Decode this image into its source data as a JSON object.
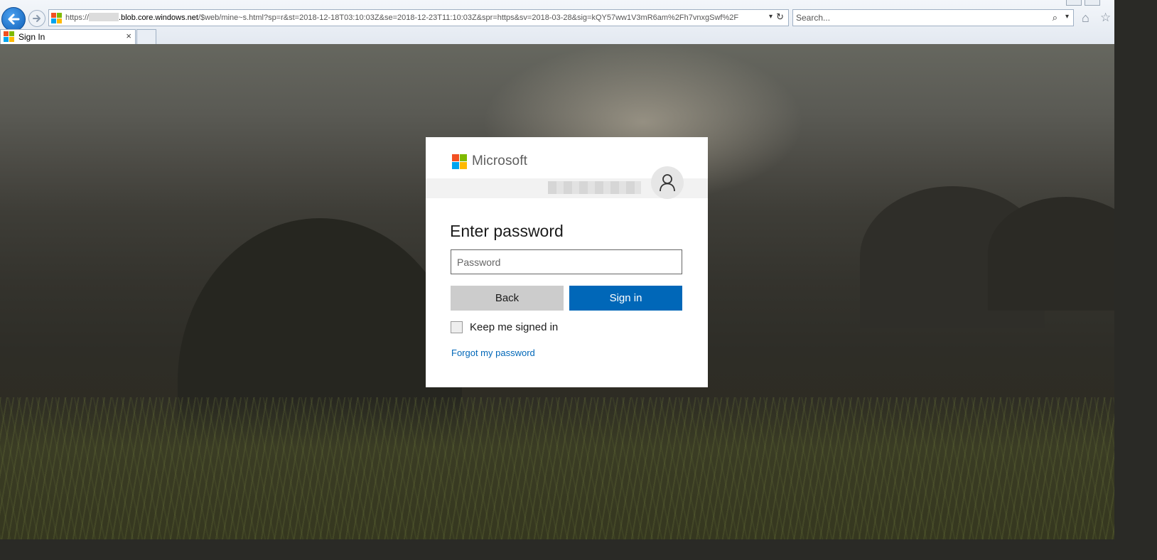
{
  "browser": {
    "url": {
      "scheme": "https://",
      "host_suffix": ".blob.core.windows.net",
      "path": "/$web/mine~s.html?sp=r&st=2018-12-18T03:10:03Z&se=2018-12-23T11:10:03Z&spr=https&sv=2018-03-28&sig=kQY57ww1V3mR6am%2Fh7vnxgSwf%2F"
    },
    "search_placeholder": "Search...",
    "tab_title": "Sign In",
    "tab_close": "×",
    "icons": {
      "back": "arrow-left-icon",
      "forward": "arrow-right-icon",
      "refresh": "↻",
      "dropdown": "▾",
      "search": "⌕",
      "home": "⌂",
      "favorites": "☆"
    }
  },
  "signin": {
    "brand": "Microsoft",
    "heading": "Enter password",
    "password_placeholder": "Password",
    "back_label": "Back",
    "signin_label": "Sign in",
    "keep_signed_in_label": "Keep me signed in",
    "forgot_label": "Forgot my password"
  },
  "colors": {
    "ms_red": "#f25022",
    "ms_green": "#7fba00",
    "ms_blue": "#00a4ef",
    "ms_yellow": "#ffb900",
    "primary": "#0067b8",
    "secondary_button": "#cccccc"
  }
}
